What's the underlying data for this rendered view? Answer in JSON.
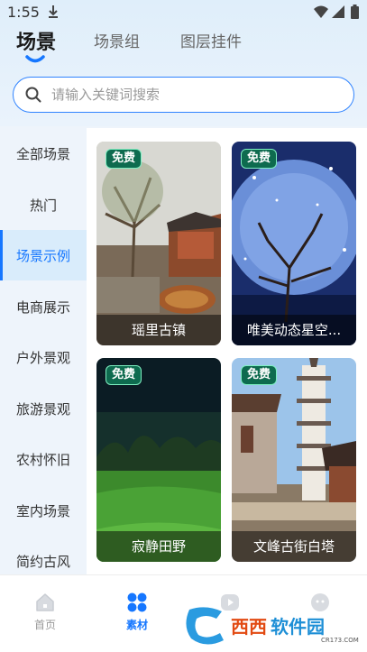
{
  "status_bar": {
    "time": "1:55"
  },
  "tabs": [
    {
      "label": "场景"
    },
    {
      "label": "场景组"
    },
    {
      "label": "图层挂件"
    }
  ],
  "search": {
    "placeholder": "请输入关键词搜索"
  },
  "sidebar": {
    "items": [
      {
        "label": "全部场景"
      },
      {
        "label": "热门"
      },
      {
        "label": "场景示例"
      },
      {
        "label": "电商展示"
      },
      {
        "label": "户外景观"
      },
      {
        "label": "旅游景观"
      },
      {
        "label": "农村怀旧"
      },
      {
        "label": "室内场景"
      },
      {
        "label": "简约古风"
      }
    ]
  },
  "cards": [
    {
      "badge": "免费",
      "caption": "瑶里古镇"
    },
    {
      "badge": "免费",
      "caption": "唯美动态星空..."
    },
    {
      "badge": "免费",
      "caption": "寂静田野"
    },
    {
      "badge": "免费",
      "caption": "文峰古街白塔"
    }
  ],
  "bottom_nav": [
    {
      "label": "首页",
      "icon": "home-icon"
    },
    {
      "label": "素材",
      "icon": "material-icon"
    },
    {
      "label": "",
      "icon": "play-icon"
    },
    {
      "label": "",
      "icon": "profile-icon"
    }
  ],
  "watermark": {
    "text": "西西软件园",
    "sub": "CR173.COM"
  },
  "colors": {
    "accent": "#1677ff",
    "badge_bg": "#0e6b4f",
    "badge_border": "#7ff0c2"
  }
}
